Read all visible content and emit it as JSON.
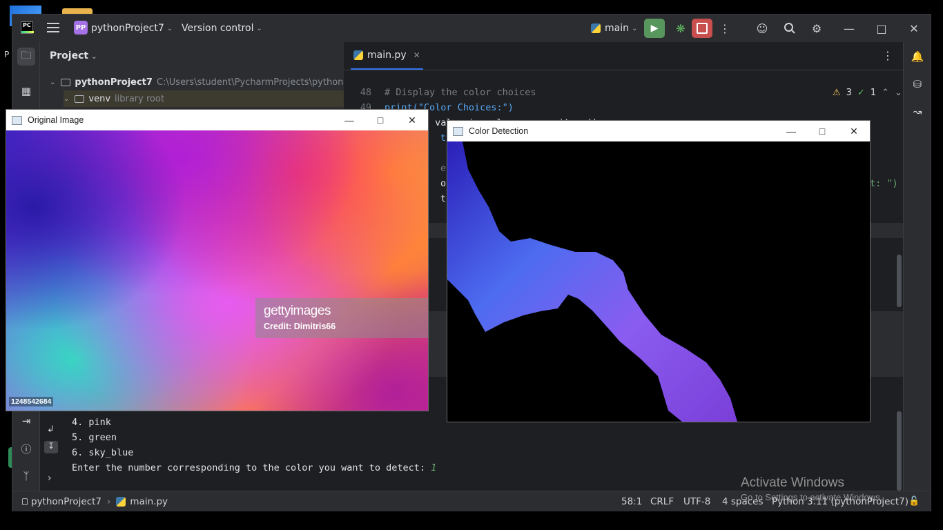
{
  "ide": {
    "project_badge": "PP",
    "project_name": "pythonProject7",
    "version_control": "Version control",
    "branch": "main"
  },
  "project_panel": {
    "title": "Project",
    "tree": [
      {
        "label": "pythonProject7",
        "detail": "C:\\Users\\student\\PycharmProjects\\pythonProject7"
      },
      {
        "label": "venv",
        "detail": "library root"
      }
    ]
  },
  "editor": {
    "tab": "main.py",
    "inspections": {
      "warnings": "3",
      "weak_warnings": "1"
    },
    "lines": [
      {
        "n": "48",
        "code": "# Display the color choices"
      },
      {
        "n": "49",
        "code": "print(\"Color Choices:\")"
      },
      {
        "n": "50",
        "code": "for key, value in color_ranges.items():"
      }
    ],
    "partial_fragments": [
      "t(f\"",
      "er i",
      "or_c",
      "tect",
      "t: \")"
    ]
  },
  "console": {
    "lines": [
      "4. pink",
      "5. green",
      "6. sky_blue"
    ],
    "prompt": "Enter the number corresponding to the color you want to detect: ",
    "input": "1"
  },
  "statusbar": {
    "crumb_project": "pythonProject7",
    "crumb_file": "main.py",
    "position": "58:1",
    "line_sep": "CRLF",
    "encoding": "UTF-8",
    "indent": "4 spaces",
    "interpreter": "Python 3.11 (pythonProject7)"
  },
  "windows": {
    "original": {
      "title": "Original Image",
      "getty_logo": "gettyimages",
      "getty_credit": "Credit: Dimitris66",
      "image_id": "1248542684"
    },
    "detection": {
      "title": "Color Detection"
    }
  },
  "watermark": {
    "title": "Activate Windows",
    "subtitle": "Go to Settings to activate Windows."
  },
  "desktop": {
    "letter": "P"
  }
}
